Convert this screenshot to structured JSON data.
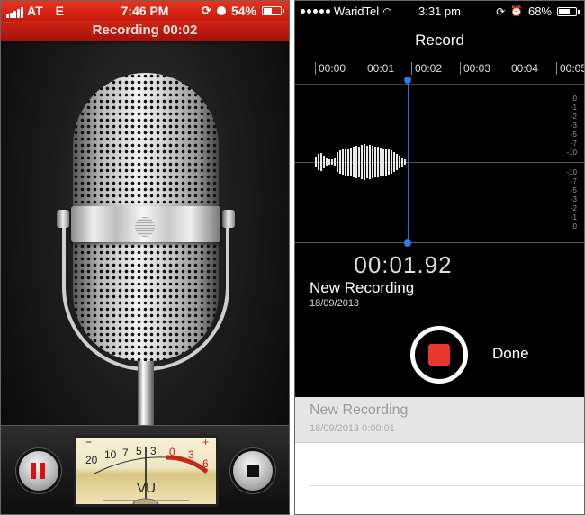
{
  "left_app": {
    "status_bar": {
      "carrier": "AT",
      "network": "E",
      "time": "7:46 PM",
      "battery_percent": "54%",
      "battery_level": 0.54,
      "icons": [
        "signal-icon",
        "rotation-lock-icon",
        "clock-icon",
        "battery-icon"
      ]
    },
    "recording_banner": "Recording  00:02",
    "vu_meter": {
      "label": "VU",
      "scale_black": [
        "20",
        "10",
        "7",
        "5",
        "3"
      ],
      "scale_red": [
        "0",
        "3",
        "6"
      ],
      "minus_sign": "−",
      "plus_sign": "+"
    },
    "buttons": {
      "pause": "pause-icon",
      "stop": "stop-icon"
    }
  },
  "right_app": {
    "status_bar": {
      "carrier": "WaridTel",
      "time": "3:31 pm",
      "battery_percent": "68%",
      "battery_level": 0.68,
      "icons": [
        "signal-dots-icon",
        "wifi-icon",
        "rotation-lock-icon",
        "alarm-icon",
        "battery-icon"
      ]
    },
    "title": "Record",
    "timeline_labels": [
      "00:00",
      "00:01",
      "00:02",
      "00:03",
      "00:04",
      "00:05"
    ],
    "db_scale_top": [
      "0",
      "-1",
      "-2",
      "-3",
      "-5",
      "-7",
      "-10"
    ],
    "db_scale_bottom": [
      "-10",
      "-7",
      "-5",
      "-3",
      "-2",
      "-1",
      "0"
    ],
    "elapsed_time": "00:01.92",
    "current_recording": {
      "name": "New Recording",
      "date": "18/09/2013"
    },
    "done_label": "Done",
    "recordings_list": [
      {
        "name": "New Recording",
        "meta": "18/09/2013  0:00:01"
      }
    ]
  }
}
